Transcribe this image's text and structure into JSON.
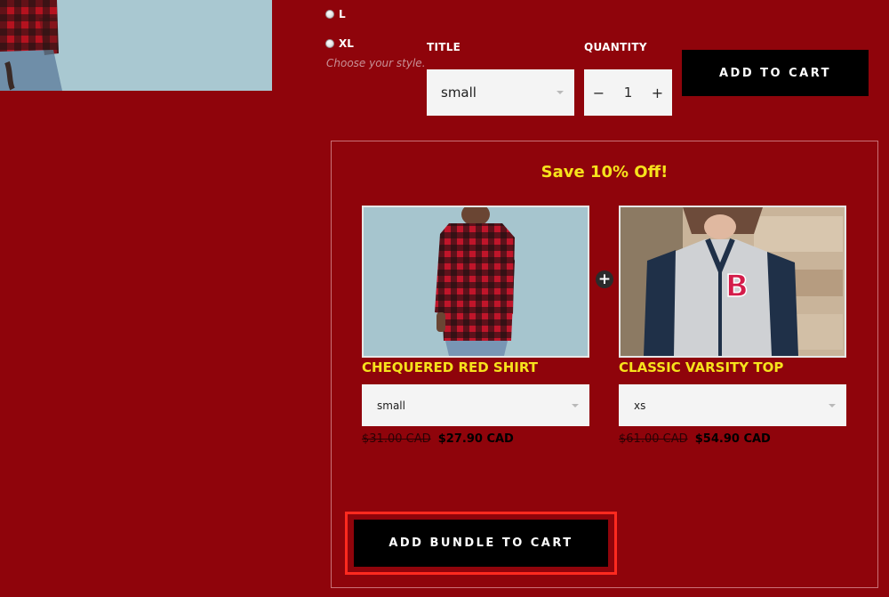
{
  "colors": {
    "page_background": "#8f040b",
    "accent_yellow": "#f6e21c",
    "button_black": "#000000",
    "highlight_red": "#ff2a1f",
    "panel_border": "#c97177"
  },
  "product_options": {
    "sizes": [
      {
        "label": "L"
      },
      {
        "label": "XL"
      }
    ],
    "style_help": "Choose your style.",
    "title_label": "TITLE",
    "title_value": "small",
    "quantity_label": "QUANTITY",
    "quantity_value": "1",
    "qty_decrease": "−",
    "qty_increase": "+",
    "add_to_cart_label": "ADD TO CART"
  },
  "bundle": {
    "heading": "Save 10% Off!",
    "plus_symbol": "+",
    "items": [
      {
        "name": "CHEQUERED RED SHIRT",
        "variant": "small",
        "old_price": "$31.00 CAD",
        "new_price": "$27.90 CAD"
      },
      {
        "name": "CLASSIC VARSITY TOP",
        "variant": "xs",
        "old_price": "$61.00 CAD",
        "new_price": "$54.90 CAD"
      }
    ],
    "add_bundle_label": "ADD BUNDLE TO CART"
  }
}
